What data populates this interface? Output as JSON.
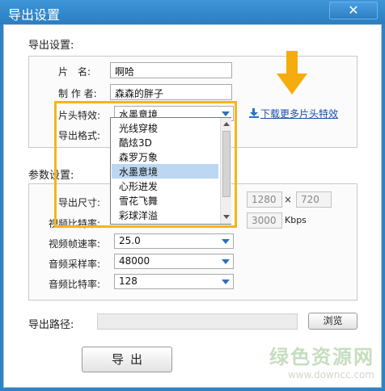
{
  "window": {
    "title": "导出设置",
    "close_label": "✕"
  },
  "export_settings": {
    "section_label": "导出设置:",
    "film_name_label": "片　名:",
    "film_name_value": "啊哈",
    "producer_label": "制 作 者:",
    "producer_value": "森森的胖子",
    "intro_effect_label": "片头特效:",
    "intro_effect_value": "水墨意境",
    "export_format_label": "导出格式:",
    "download_more_label": "下载更多片头特效"
  },
  "intro_effect_dropdown": {
    "options": [
      "光线穿梭",
      "酷炫3D",
      "森罗万象",
      "水墨意境",
      "心形迸发",
      "雪花飞舞",
      "彩球洋溢"
    ],
    "selected": "水墨意境"
  },
  "params": {
    "section_label": "参数设置:",
    "export_size_label": "导出尺寸:",
    "width_value": "1280",
    "height_value": "720",
    "times_symbol": "×",
    "video_bitrate_label": "视频比特率:",
    "video_bitrate_value": "3000",
    "video_bitrate_unit": "Kbps",
    "frame_rate_label": "视频帧速率:",
    "frame_rate_value": "25.0",
    "sample_rate_label": "音频采样率:",
    "sample_rate_value": "48000",
    "audio_bitrate_label": "音频比特率:",
    "audio_bitrate_value": "128"
  },
  "output": {
    "path_label": "导出路径:",
    "path_value": "",
    "browse_label": "浏览",
    "export_label": "导出"
  },
  "watermark": {
    "title": "绿色资源网",
    "url": "www.downcc.com"
  },
  "colors": {
    "title_bar": "#2f83c4",
    "highlight": "#f4b617",
    "link": "#1a4fa8",
    "selected_item": "#bcd7f1"
  }
}
